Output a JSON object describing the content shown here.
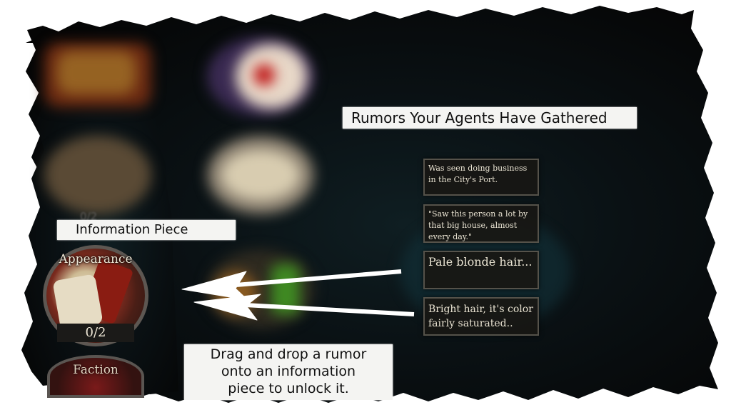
{
  "header": {
    "title": "Rumors Your Agents Have Gathered"
  },
  "info_label": "Information Piece",
  "medal": {
    "title": "Appearance",
    "count": "0/2"
  },
  "next_medal": {
    "title": "Faction"
  },
  "ghost_counter": "0/2",
  "rumors": [
    "Was seen doing business in the City's Port.",
    "\"Saw this person a lot by that big house, almost every day.\"",
    "Pale blonde hair...",
    "Bright hair, it's color fairly saturated.."
  ],
  "instructions": {
    "line1": "Drag and drop a rumor",
    "line2": "onto an information",
    "line3": "piece to unlock it."
  },
  "colors": {
    "label_bg": "#f4f4f2",
    "card_bg": "#181714",
    "card_border": "#55524a",
    "card_text": "#e9e3d2",
    "medal_red": "#7a2a1e"
  },
  "icons": [
    "arrow-pointer"
  ]
}
